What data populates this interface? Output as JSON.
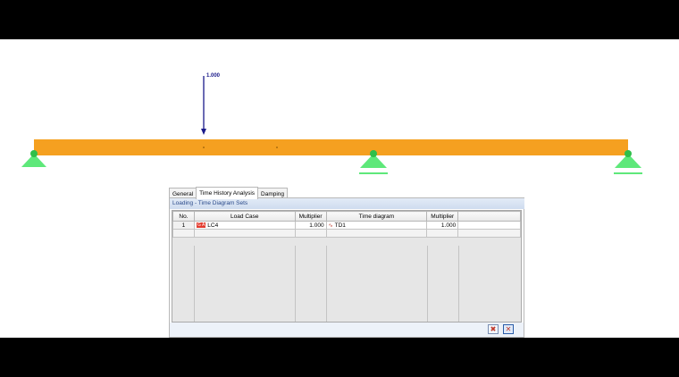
{
  "beam": {
    "load_value": "1.000",
    "beam_color": "#F5A020",
    "support_color": "#5EE87A",
    "load_color": "#1A1A8A"
  },
  "dialog": {
    "tabs": [
      "General",
      "Time History Analysis",
      "Damping"
    ],
    "active_tab": "Time History Analysis",
    "group_title": "Loading - Time Diagram Sets",
    "columns": [
      "No.",
      "Load Case",
      "Multiplier",
      "Time diagram",
      "Multiplier"
    ],
    "rows": [
      {
        "no": "1",
        "load_case_badge": "G A",
        "load_case": "LC4",
        "multiplier": "1.000",
        "time_diagram": "TD1",
        "time_diagram_icon": "time-diagram-icon",
        "td_multiplier": "1.000"
      }
    ],
    "buttons": [
      {
        "name": "delete-row-icon"
      },
      {
        "name": "clear-all-icon"
      }
    ]
  }
}
